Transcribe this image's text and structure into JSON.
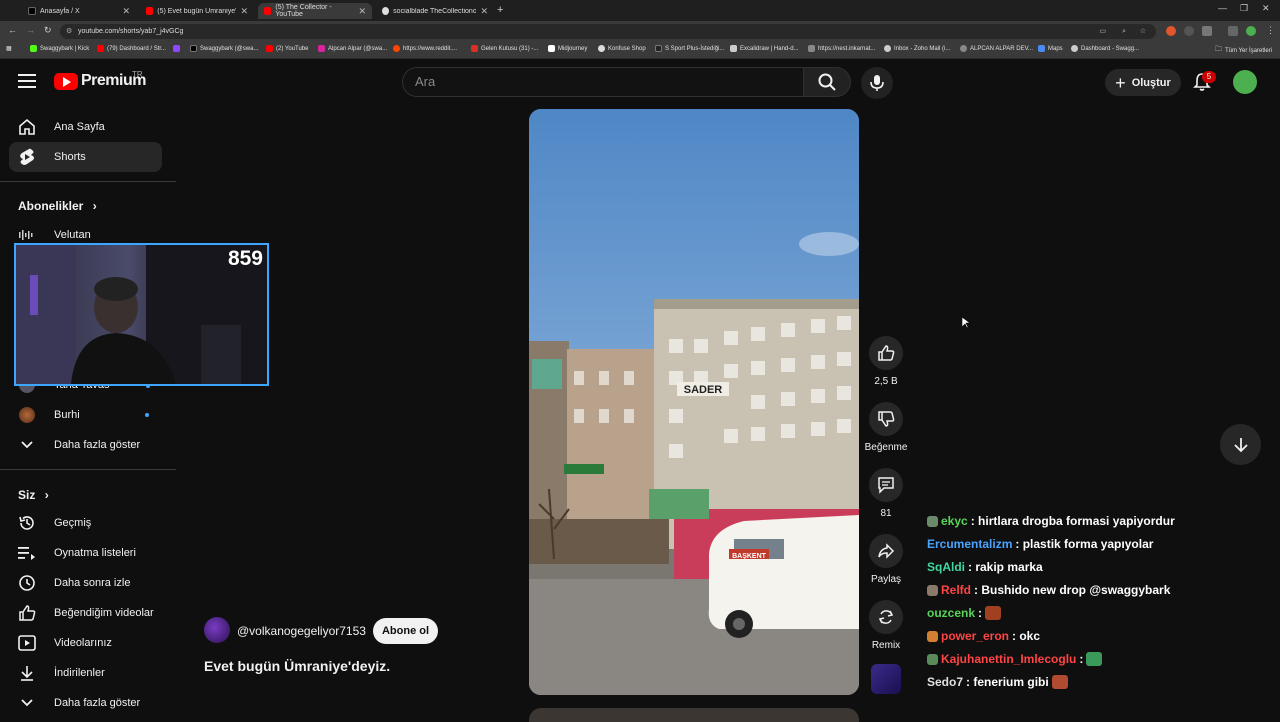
{
  "browser": {
    "tabs": [
      {
        "title": "Anasayfa / X",
        "active": false
      },
      {
        "title": "(5) Evet bugün Ümraniye'de",
        "active": false
      },
      {
        "title": "(5) The Collector - YouTube",
        "active": true
      },
      {
        "title": "socialblade TheCollectionofxe",
        "active": false
      }
    ],
    "url": "youtube.com/shorts/yab7_j4vGCg",
    "bookmarks": [
      "Swaggybark | Kick",
      "(79) Dashboard / Str...",
      "",
      "Swaggybark (@swa...",
      "(2) YouTube",
      "Alpcan Alpar (@swa...",
      "https://www.reddit....",
      "Gelen Kutusu (31) -...",
      "Midjourney",
      "Konfuse Shop",
      "S Sport Plus-İstediği...",
      "Excalidraw | Hand-d...",
      "https://nest.inkarnat...",
      "Inbox - Zoho Mail (i...",
      "ALPCAN ALPAR DEV...",
      "Maps",
      "Dashboard - Swagg..."
    ],
    "bookmarks_right": "Tüm Yer İşaretleri"
  },
  "header": {
    "logo_text": "Premium",
    "logo_region": "TR",
    "search_placeholder": "Ara",
    "create_label": "Oluştur",
    "notification_count": "5"
  },
  "sidebar": {
    "home": "Ana Sayfa",
    "shorts": "Shorts",
    "subs_heading": "Abonelikler",
    "subs": [
      {
        "name": "Velutan",
        "dot": false
      },
      {
        "name": "Taha Tavas",
        "dot": false
      },
      {
        "name": "Burhi",
        "dot": true
      }
    ],
    "show_more_subs": "Daha fazla göster",
    "you_heading": "Siz",
    "you_items": [
      "Geçmiş",
      "Oynatma listeleri",
      "Daha sonra izle",
      "Beğendiğim videolar",
      "Videolarınız",
      "İndirilenler",
      "Daha fazla göster"
    ]
  },
  "webcam": {
    "viewer_count": "859"
  },
  "video": {
    "channel": "@volkanogegeliyor7153",
    "subscribe_label": "Abone ol",
    "title": "Evet bugün Ümraniye'deyiz.",
    "sign_text": "SADER",
    "van_text": "BAŞKENT",
    "likes": "2,5 B",
    "dislike_label": "Beğenme",
    "comments": "81",
    "share_label": "Paylaş",
    "remix_label": "Remix"
  },
  "chat": [
    {
      "user": "ekyc",
      "msg": ": hirtlara drogba formasi yapiyordur",
      "color": "#5ad35a",
      "badge": "#6a8a6a",
      "emote": ""
    },
    {
      "user": "Ercumentalizm",
      "msg": ": plastik forma yapıyolar",
      "color": "#4aa3ff",
      "badge": "",
      "emote": ""
    },
    {
      "user": "SqAldi",
      "msg": ": rakip marka",
      "color": "#3fd9a0",
      "badge": "",
      "emote": ""
    },
    {
      "user": "Relfd",
      "msg": ": Bushido new drop @swaggybark",
      "color": "#ff4444",
      "badge": "#8a7a6a",
      "emote": ""
    },
    {
      "user": "ouzcenk",
      "msg": ":",
      "color": "#5ad35a",
      "badge": "",
      "emote": "#a04020"
    },
    {
      "user": "power_eron",
      "msg": ": okc",
      "color": "#ff4444",
      "badge": "#d08030",
      "emote": ""
    },
    {
      "user": "Kajuhanettin_Imlecoglu",
      "msg": ":",
      "color": "#ff4444",
      "badge": "#5a8a5a",
      "emote": "#3a9a5a"
    },
    {
      "user": "Sedo7",
      "msg": ": fenerium gibi",
      "color": "#e0e0e0",
      "badge": "",
      "emote": "#b04a30"
    }
  ]
}
